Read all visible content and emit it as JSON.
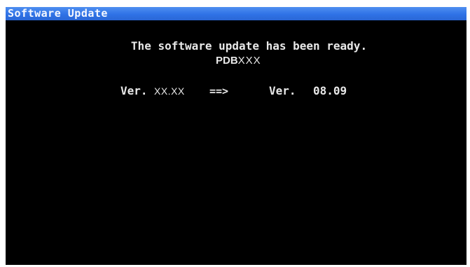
{
  "window": {
    "title": "Software Update"
  },
  "message": {
    "line": "The software update has been ready.",
    "model_prefix": "PDB",
    "model_suffix": "XXX"
  },
  "version": {
    "current_label": "Ver.",
    "current_value": "XX.XX",
    "arrow": "==>",
    "new_label": "Ver.",
    "new_value": "08.09"
  },
  "colors": {
    "title_bar": "#2f72e6",
    "screen_background": "#000000",
    "text": "#e8e8e8"
  }
}
